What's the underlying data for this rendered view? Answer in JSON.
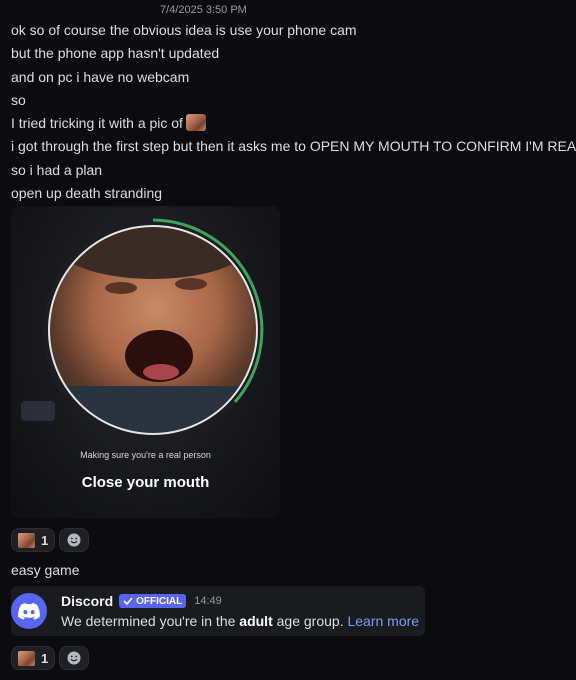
{
  "timestamp": "7/4/2025 3:50 PM",
  "messages": [
    "ok so of course the obvious idea is use your phone cam",
    "but the phone app hasn't updated",
    "and on pc i have no webcam",
    "so",
    "I tried tricking it with a pic of",
    "i got through the first step but then it asks me to OPEN MY MOUTH TO CONFIRM I'M REAL",
    "so i had a plan",
    "open up death stranding"
  ],
  "attachment": {
    "caption": "Making sure you're a real person",
    "action": "Close your mouth"
  },
  "reactions_1": {
    "count": "1",
    "emoji": "face-emoji",
    "add_icon": "smiley-add-icon"
  },
  "after_message": "easy game",
  "system_message": {
    "author": "Discord",
    "badge": "OFFICIAL",
    "time": "14:49",
    "text_before": "We determined you're in the",
    "text_bold": "adult",
    "text_after": "age group.",
    "link": "Learn more"
  },
  "reactions_2": {
    "count": "1",
    "emoji": "face-emoji",
    "add_icon": "smiley-add-icon"
  },
  "colors": {
    "blurple": "#5865f2",
    "progress_green": "#3ba55d",
    "background": "#0c0c0e"
  }
}
